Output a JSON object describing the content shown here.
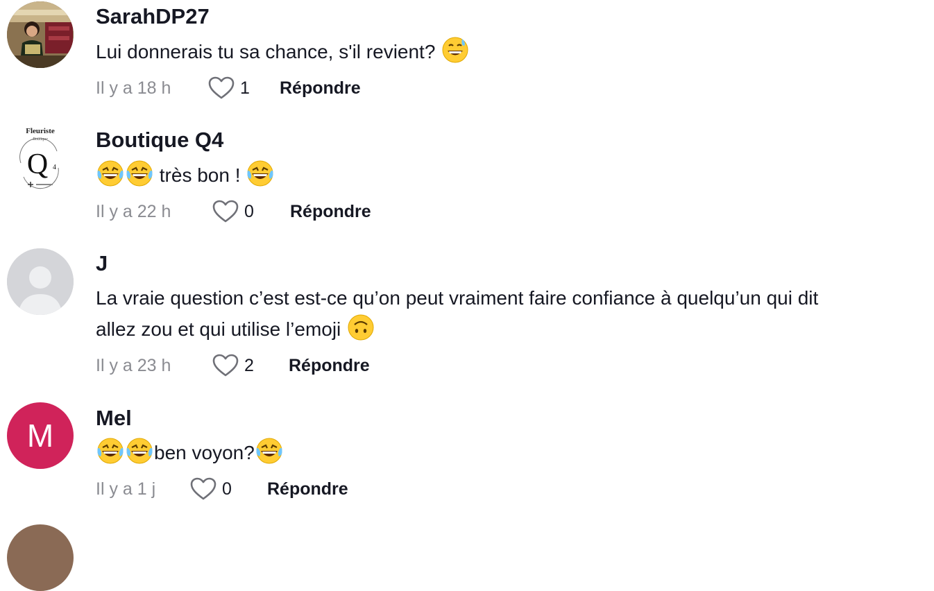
{
  "comments": [
    {
      "username": "SarahDP27",
      "text": "Lui donnerais tu sa chance, s'il revient?",
      "time": "Il y a 18 h",
      "likes": "1",
      "reply_label": "Répondre",
      "avatar": "photo-avatar"
    },
    {
      "username": "Boutique Q4",
      "text": "très bon !",
      "time": "Il y a 22 h",
      "likes": "0",
      "reply_label": "Répondre",
      "avatar": "logo-avatar",
      "avatar_logo": {
        "top": "Fleuriste",
        "script": "Boutique ",
        "monogram": "Q",
        "sub": "4"
      }
    },
    {
      "username": "J",
      "text_line1": "La vraie question c’est est-ce qu’on peut vraiment faire confiance à quelqu’un qui dit",
      "text_line2": "allez zou et qui utilise l’emoji",
      "time": "Il y a 23 h",
      "likes": "2",
      "reply_label": "Répondre",
      "avatar": "default-avatar"
    },
    {
      "username": "Mel",
      "text": "ben voyon?",
      "time": "Il y a 1 j",
      "likes": "0",
      "reply_label": "Répondre",
      "avatar": "letter-avatar",
      "avatar_letter": "M",
      "avatar_color": "#d0235a"
    }
  ]
}
